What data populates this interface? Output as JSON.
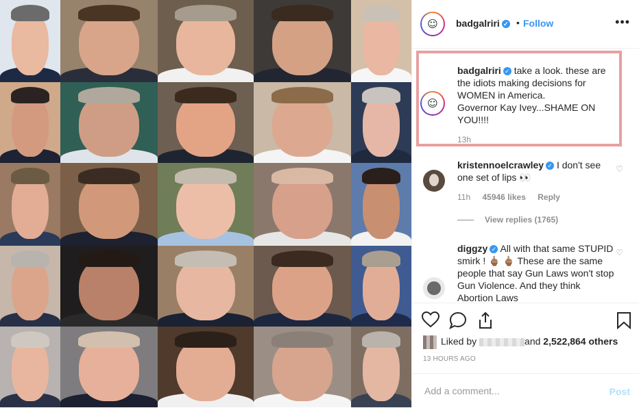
{
  "post": {
    "username": "badgalriri",
    "follow_label": "Follow",
    "dot": "•",
    "more_label": "•••",
    "avatar_glyph": "☺"
  },
  "caption": {
    "username": "badgalriri",
    "text_line1": "take a look. these are the idiots making decisions for WOMEN in America.",
    "text_line2": "Governor Kay Ivey...SHAME ON YOU!!!!",
    "time": "13h"
  },
  "comments": [
    {
      "username": "kristennoelcrawley",
      "text": "I don't see one set of lips 👀",
      "time": "11h",
      "likes": "45946 likes",
      "reply_label": "Reply",
      "view_replies": "View replies (1765)"
    },
    {
      "username": "diggzy",
      "text": "All with that same STUPID smirk ! 🖕🏽 🖕🏽  These are the same people that say Gun Laws won't stop Gun Violence. And they think Abortion Laws"
    }
  ],
  "actions": {
    "liked_by_prefix": "Liked by",
    "liked_by_suffix": "and",
    "others": "2,522,864 others",
    "posted": "13 HOURS AGO"
  },
  "comment_bar": {
    "placeholder": "Add a comment...",
    "post_label": "Post"
  },
  "colors": {
    "accent": "#3897f0",
    "highlight_border": "#e8a0a0",
    "post_disabled": "#b2dffc"
  },
  "photo": {
    "skin_tones": [
      "#e9b9a0",
      "#d8a48a",
      "#e7b69c",
      "#d4a184",
      "#e9b7a2",
      "#d49a80",
      "#cf9d86",
      "#e3a486",
      "#dca88f",
      "#e6b7a6",
      "#e2ad94",
      "#d19979",
      "#ecbea8",
      "#d6a08a",
      "#c98f71",
      "#dba58b",
      "#b9806a",
      "#e7b7a1",
      "#dca288",
      "#e2ad96",
      "#e8b69f",
      "#e7b09a",
      "#e2ad93",
      "#d7a48d",
      "#e4b7a3"
    ],
    "backgrounds": [
      "#dfe6ee",
      "#97826c",
      "#6e5e4e",
      "#3e3a38",
      "#d4c0a8",
      "#cfa98a",
      "#2f5f55",
      "#6d5f52",
      "#c9b9a6",
      "#2d3b56",
      "#9a7a63",
      "#7b5f49",
      "#6f7d58",
      "#8b786c",
      "#5d7bab",
      "#c6b7aa",
      "#1f1d1e",
      "#9a7f67",
      "#6b5a4d",
      "#3f5b91",
      "#b8b2b0",
      "#7e7c7f",
      "#4f3a2c",
      "#9b8f85",
      "#7e6e62"
    ],
    "suits": [
      "#1e2a44",
      "#2a2e3a",
      "#f1f1f1",
      "#222633",
      "#f6f6f6",
      "#1d2235",
      "#dfe4ea",
      "#1e2530",
      "#f4f4f4",
      "#202a3f",
      "#2b3a59",
      "#1d2130",
      "#a7c2e0",
      "#e6e6e6",
      "#f2f2f2",
      "#273047",
      "#2a2a2a",
      "#1a2233",
      "#1d2740",
      "#1f2b4a",
      "#2a3147",
      "#1c2030",
      "#f0f0f0",
      "#f5f5f5",
      "#394253"
    ],
    "hairs": [
      "#6b6b6b",
      "#4a3525",
      "#a69c8d",
      "#3a2a20",
      "#c9c1b5",
      "#2b2321",
      "#b0a89c",
      "#3c2a1f",
      "#8b6b4a",
      "#c8c3be",
      "#6b5b44",
      "#3a2c22",
      "#c3bbae",
      "#d9b9a4",
      "#2a1f1b",
      "#b8b3ad",
      "#241a15",
      "#c4bdb3",
      "#3a2a20",
      "#a99e90",
      "#cfc8c0",
      "#d2bfae",
      "#2c2119",
      "#8a8078",
      "#b9b3ab"
    ]
  }
}
